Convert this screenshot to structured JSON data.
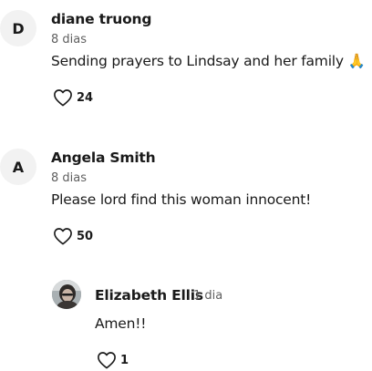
{
  "comments": [
    {
      "avatar_letter": "D",
      "author": "diane truong",
      "time": "8 dias",
      "text": "Sending prayers to Lindsay and her family 🙏",
      "likes": "24",
      "like_icon": "heart-outline-icon"
    },
    {
      "avatar_letter": "A",
      "author": "Angela Smith",
      "time": "8 dias",
      "text": "Please lord find this woman innocent!",
      "likes": "50",
      "like_icon": "heart-outline-icon"
    }
  ],
  "reply": {
    "author": "Elizabeth Ellis",
    "time": "1 dia",
    "text": "Amen!!",
    "likes": "1",
    "like_icon": "heart-outline-icon"
  },
  "colors": {
    "text": "#1a1a1a",
    "muted": "#5f5f5f",
    "avatar_bg": "#f2f2f2"
  }
}
